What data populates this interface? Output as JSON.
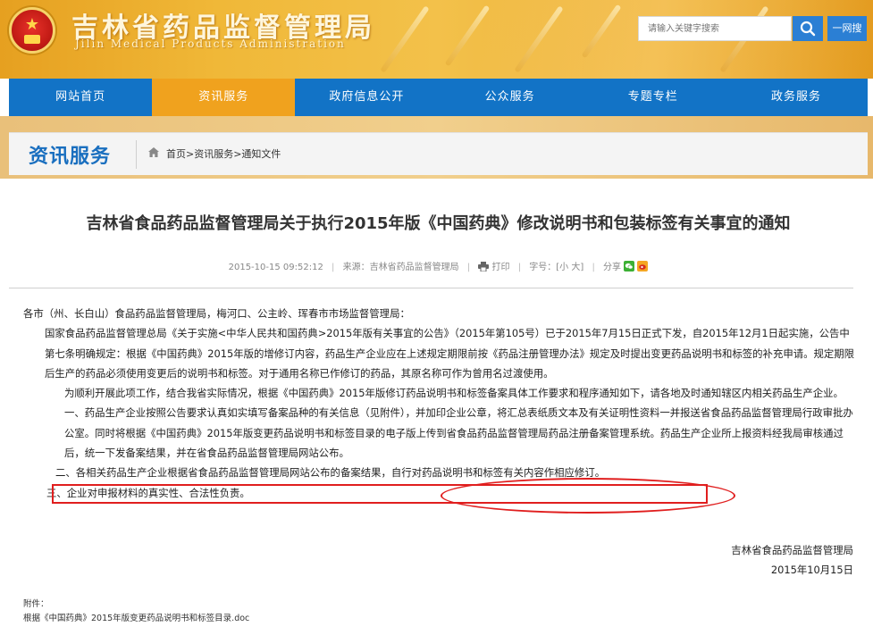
{
  "header": {
    "title": "吉林省药品监督管理局",
    "subtitle": "Jilin Medical Products Administration",
    "search_placeholder": "请输入关键字搜索",
    "global_search_label": "一网搜"
  },
  "nav": {
    "items": [
      "网站首页",
      "资讯服务",
      "政府信息公开",
      "公众服务",
      "专题专栏",
      "政务服务"
    ],
    "active_index": 1
  },
  "section": {
    "title": "资讯服务",
    "breadcrumb": "首页>资讯服务>通知文件"
  },
  "article": {
    "title": "吉林省食品药品监督管理局关于执行2015年版《中国药典》修改说明书和包装标签有关事宜的通知",
    "date": "2015-10-15 09:52:12",
    "source": "来源：吉林省药品监督管理局",
    "print_label": "打印",
    "font_size_label": "字号：[小 大]",
    "share_label": "分享",
    "paragraphs": [
      "各市（州、长白山）食品药品监督管理局，梅河口、公主岭、珲春市市场监督管理局：",
      "国家食品药品监督管理总局《关于实施<中华人民共和国药典>2015年版有关事宜的公告》（2015年第105号）已于2015年7月15日正式下发，自2015年12月1日起实施，公告中第七条明确规定：根据《中国药典》2015年版的增修订内容，药品生产企业应在上述规定期限前按《药品注册管理办法》规定及时提出变更药品说明书和标签的补充申请。规定期限后生产的药品必须使用变更后的说明书和标签。对于通用名称已作修订的药品，其原名称可作为曾用名过渡使用。",
      "为顺利开展此项工作，结合我省实际情况，根据《中国药典》2015年版修订药品说明书和标签备案具体工作要求和程序通知如下，请各地及时通知辖区内相关药品生产企业。",
      "一、药品生产企业按照公告要求认真如实填写备案品种的有关信息（见附件），并加印企业公章，将汇总表纸质文本及有关证明性资料一并报送省食品药品监督管理局行政审批办公室。同时将根据《中国药典》2015年版变更药品说明书和标签目录的电子版上传到省食品药品监督管理局药品注册备案管理系统。药品生产企业所上报资料经我局审核通过后，统一下发备案结果，并在省食品药品监督管理局网站公布。",
      "二、各相关药品生产企业根据省食品药品监督管理局网站公布的备案结果，自行对药品说明书和标签有关内容作相应修订。",
      "三、企业对申报材料的真实性、合法性负责。"
    ],
    "signature_org": "吉林省食品药品监督管理局",
    "signature_date": "2015年10月15日",
    "attachment_label": "附件：",
    "attachment_file": "根据《中国药典》2015年版变更药品说明书和标签目录.doc"
  },
  "colors": {
    "nav_blue": "#1273c6",
    "nav_active": "#f0a21e",
    "section_title": "#1a6fbf",
    "highlight_red": "#e01e1e"
  }
}
